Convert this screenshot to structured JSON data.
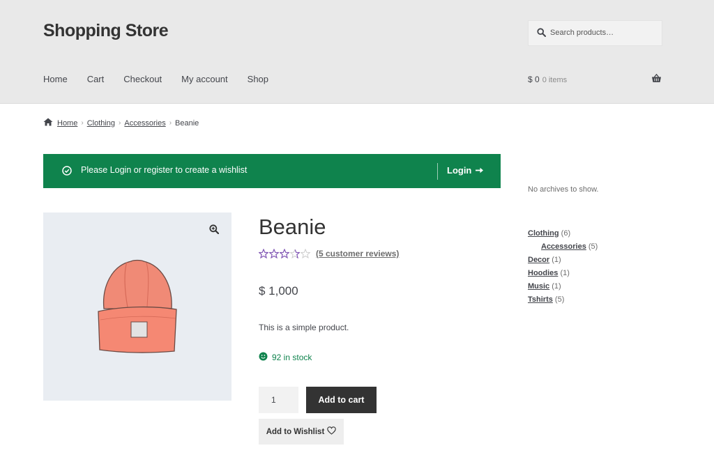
{
  "site": {
    "title": "Shopping Store"
  },
  "search": {
    "placeholder": "Search products…"
  },
  "nav": {
    "items": [
      "Home",
      "Cart",
      "Checkout",
      "My account",
      "Shop"
    ]
  },
  "cart": {
    "amount": "$ 0",
    "items": "0 items"
  },
  "breadcrumb": {
    "items": [
      "Home",
      "Clothing",
      "Accessories"
    ],
    "current": "Beanie"
  },
  "notice": {
    "message": "Please Login or register to create a wishlist",
    "login_label": "Login"
  },
  "product": {
    "title": "Beanie",
    "rating": 3.5,
    "reviews_label": "(5 customer reviews)",
    "price": "$ 1,000",
    "description": "This is a simple product.",
    "stock": "92 in stock",
    "quantity": "1",
    "add_to_cart_label": "Add to cart",
    "wishlist_label": "Add to Wishlist"
  },
  "sidebar": {
    "archives_text": "No archives to show.",
    "categories": [
      {
        "name": "Clothing",
        "count": "(6)",
        "sub": false
      },
      {
        "name": "Accessories",
        "count": "(5)",
        "sub": true
      },
      {
        "name": "Decor",
        "count": "(1)",
        "sub": false
      },
      {
        "name": "Hoodies",
        "count": "(1)",
        "sub": false
      },
      {
        "name": "Music",
        "count": "(1)",
        "sub": false
      },
      {
        "name": "Tshirts",
        "count": "(5)",
        "sub": false
      }
    ]
  },
  "colors": {
    "notice_bg": "#0f834d",
    "star": "#7f54b3",
    "button_dark": "#333333",
    "header_bg": "#e9e9e9"
  },
  "icons": [
    "search-icon",
    "basket-icon",
    "home-icon",
    "check-circle-icon",
    "arrow-right-icon",
    "zoom-icon",
    "star-icon",
    "smile-icon",
    "heart-icon"
  ]
}
